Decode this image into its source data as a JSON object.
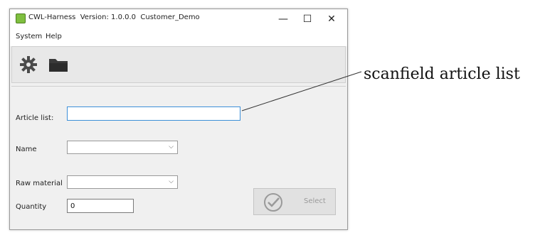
{
  "window": {
    "title": "CWL-Harness  Version: 1.0.0.0  Customer_Demo",
    "controls": {
      "minimize": "—",
      "maximize": "☐",
      "close": "✕"
    }
  },
  "menu": [
    "System",
    "Help"
  ],
  "toolbar": {
    "settings_icon": "gear-icon",
    "open_icon": "folder-icon"
  },
  "form": {
    "article_list": {
      "label": "Article list:",
      "value": ""
    },
    "name": {
      "label": "Name",
      "value": ""
    },
    "raw_material": {
      "label": "Raw material",
      "value": ""
    },
    "quantity": {
      "label": "Quantity",
      "value": "0"
    }
  },
  "select_button": {
    "label": "Select",
    "enabled": false,
    "icon": "checkmark-circle-icon"
  },
  "annotation": {
    "text": "scanfield article list"
  },
  "colors": {
    "focus_border": "#3c8fd8",
    "toolbar_bg": "#e8e8e8",
    "window_bg": "#f0f0f0"
  }
}
